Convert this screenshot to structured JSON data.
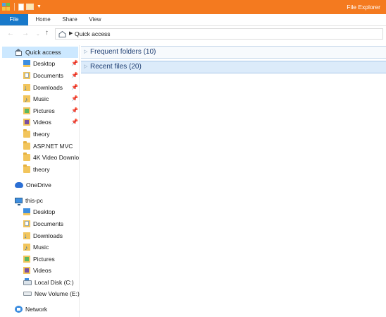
{
  "window": {
    "title": "File Explorer"
  },
  "ribbon": {
    "tabs": [
      "File",
      "Home",
      "Share",
      "View"
    ]
  },
  "address": {
    "path": "Quick access"
  },
  "nav_pane": {
    "quick_access": {
      "label": "Quick access",
      "items": [
        {
          "label": "Desktop",
          "icon": "desktop-icon",
          "pinned": true
        },
        {
          "label": "Documents",
          "icon": "documents-icon",
          "pinned": true
        },
        {
          "label": "Downloads",
          "icon": "downloads-icon",
          "pinned": true
        },
        {
          "label": "Music",
          "icon": "music-icon",
          "pinned": true
        },
        {
          "label": "Pictures",
          "icon": "pictures-icon",
          "pinned": true
        },
        {
          "label": "Videos",
          "icon": "videos-icon",
          "pinned": true
        },
        {
          "label": "theory",
          "icon": "folder-icon",
          "pinned": false
        },
        {
          "label": "ASP.NET MVC",
          "icon": "folder-icon",
          "pinned": false
        },
        {
          "label": "4K Video Downlo",
          "icon": "folder-icon",
          "pinned": false
        },
        {
          "label": "theory",
          "icon": "folder-icon",
          "pinned": false
        }
      ]
    },
    "onedrive": {
      "label": "OneDrive"
    },
    "this_pc": {
      "label": "this-pc",
      "items": [
        {
          "label": "Desktop",
          "icon": "desktop-icon"
        },
        {
          "label": "Documents",
          "icon": "documents-icon"
        },
        {
          "label": "Downloads",
          "icon": "downloads-icon"
        },
        {
          "label": "Music",
          "icon": "music-icon"
        },
        {
          "label": "Pictures",
          "icon": "pictures-icon"
        },
        {
          "label": "Videos",
          "icon": "videos-icon"
        },
        {
          "label": "Local Disk (C:)",
          "icon": "local-disk-icon"
        },
        {
          "label": "New Volume (E:)",
          "icon": "drive-icon"
        }
      ]
    },
    "network": {
      "label": "Network"
    }
  },
  "content": {
    "groups": [
      {
        "label": "Frequent folders (10)"
      },
      {
        "label": "Recent files (20)"
      }
    ]
  },
  "colors": {
    "titlebar": "#f47a1f",
    "file_tab": "#1979ca",
    "selection": "#cce8ff"
  }
}
